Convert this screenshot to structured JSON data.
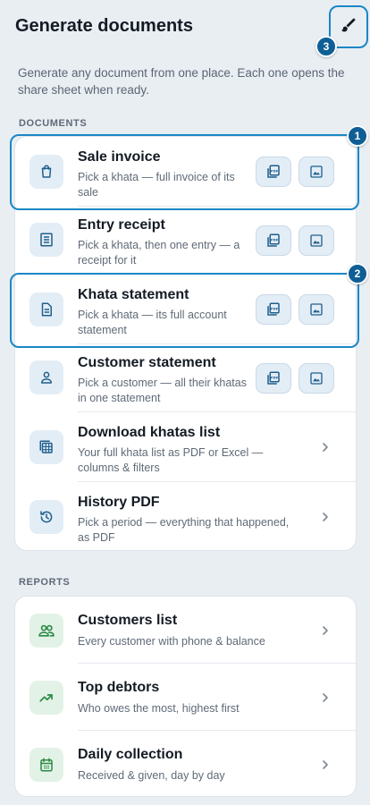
{
  "header": {
    "title": "Generate documents",
    "subtitle": "Generate any document from one place. Each one opens the share sheet when ready.",
    "brush_badge": "3",
    "brush_icon": "paintbrush-icon"
  },
  "documents": {
    "label": "DOCUMENTS",
    "items": [
      {
        "title": "Sale invoice",
        "desc": "Pick a khata — full invoice of its sale",
        "icon": "shopping-bag-icon",
        "badge": "1"
      },
      {
        "title": "Entry receipt",
        "desc": "Pick a khata, then one entry — a receipt for it",
        "icon": "receipt-icon"
      },
      {
        "title": "Khata statement",
        "desc": "Pick a khata — its full account statement",
        "icon": "document-icon",
        "badge": "2"
      },
      {
        "title": "Customer statement",
        "desc": "Pick a customer — all their khatas in one statement",
        "icon": "person-icon"
      },
      {
        "title": "Download khatas list",
        "desc": "Your full khata list as PDF or Excel — columns & filters",
        "icon": "spreadsheet-icon"
      },
      {
        "title": "History PDF",
        "desc": "Pick a period — everything that happened, as PDF",
        "icon": "history-icon"
      }
    ],
    "pdf_label": "PDF"
  },
  "reports": {
    "label": "REPORTS",
    "items": [
      {
        "title": "Customers list",
        "desc": "Every customer with phone & balance",
        "icon": "people-icon"
      },
      {
        "title": "Top debtors",
        "desc": "Who owes the most, highest first",
        "icon": "trending-up-icon"
      },
      {
        "title": "Daily collection",
        "desc": "Received & given, day by day",
        "icon": "calendar-icon"
      }
    ]
  },
  "colors": {
    "accent": "#1b87c6",
    "badge": "#0f5f96",
    "doc_icon": "#1f5f8b",
    "report_icon": "#2a8a45",
    "background": "#e9eef3"
  }
}
